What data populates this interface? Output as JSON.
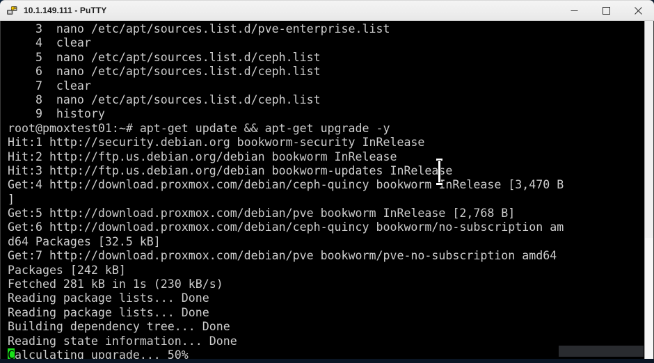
{
  "window": {
    "title": "10.1.149.111 - PuTTY",
    "app_icon": "putty-icon",
    "controls": {
      "minimize": "Minimize",
      "maximize": "Maximize",
      "close": "Close"
    }
  },
  "terminal": {
    "prompt": "root@pmoxtest01:~#",
    "cursor_char": "C",
    "lines": [
      "    3  nano /etc/apt/sources.list.d/pve-enterprise.list",
      "    4  clear",
      "    5  nano /etc/apt/sources.list.d/ceph.list",
      "    6  nano /etc/apt/sources.list.d/ceph.list",
      "    7  clear",
      "    8  nano /etc/apt/sources.list.d/ceph.list",
      "    9  history",
      "root@pmoxtest01:~# apt-get update && apt-get upgrade -y",
      "Hit:1 http://security.debian.org bookworm-security InRelease",
      "Hit:2 http://ftp.us.debian.org/debian bookworm InRelease",
      "Hit:3 http://ftp.us.debian.org/debian bookworm-updates InRelease",
      "Get:4 http://download.proxmox.com/debian/ceph-quincy bookworm InRelease [3,470 B",
      "]",
      "Get:5 http://download.proxmox.com/debian/pve bookworm InRelease [2,768 B]",
      "Get:6 http://download.proxmox.com/debian/ceph-quincy bookworm/no-subscription am",
      "d64 Packages [32.5 kB]",
      "Get:7 http://download.proxmox.com/debian/pve bookworm/pve-no-subscription amd64",
      "Packages [242 kB]",
      "Fetched 281 kB in 1s (230 kB/s)",
      "Reading package lists... Done",
      "Reading package lists... Done",
      "Building dependency tree... Done",
      "Reading state information... Done"
    ],
    "last_line_rest": "alculating upgrade... 50%"
  },
  "colors": {
    "terminal_bg": "#000000",
    "terminal_fg": "#cdcdcd",
    "cursor": "#19e219",
    "titlebar_bg": "#eeeeee",
    "titlebar_fg": "#1c1c1c"
  }
}
